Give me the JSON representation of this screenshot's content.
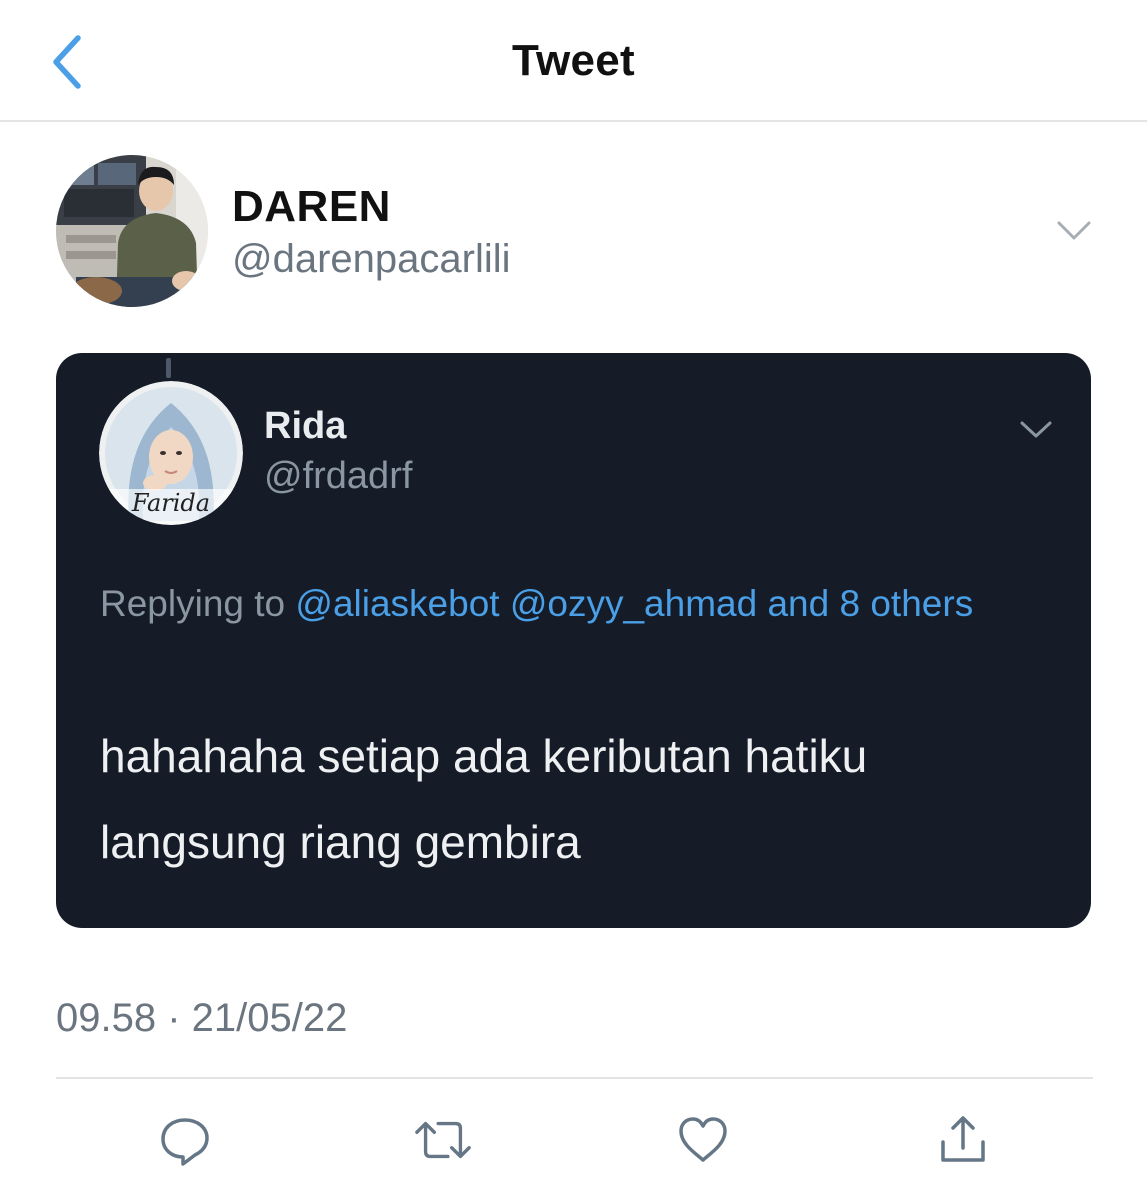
{
  "header": {
    "title": "Tweet",
    "back_icon": "chevron-left-icon",
    "accent_color": "#4a9fe6"
  },
  "tweet": {
    "author": {
      "name": "DAREN",
      "handle": "@darenpacarlili",
      "menu_icon": "chevron-down-icon"
    },
    "quoted_tweet": {
      "background_color": "#151c28",
      "author": {
        "name": "Rida",
        "handle": "@frdadrf",
        "avatar_watermark": "Farida",
        "menu_icon": "chevron-down-icon"
      },
      "replying_prefix": "Replying to",
      "mentions": [
        "@aliaskebot",
        "@ozyy_ahmad"
      ],
      "replying_others": "and 8 others",
      "text": "hahahaha setiap ada keributan hatiku langsung riang gembira"
    },
    "timestamp": "09.58 · 21/05/22"
  },
  "actions": [
    {
      "name": "reply",
      "icon": "comment-icon"
    },
    {
      "name": "retweet",
      "icon": "retweet-icon"
    },
    {
      "name": "like",
      "icon": "heart-icon"
    },
    {
      "name": "share",
      "icon": "share-icon"
    }
  ]
}
